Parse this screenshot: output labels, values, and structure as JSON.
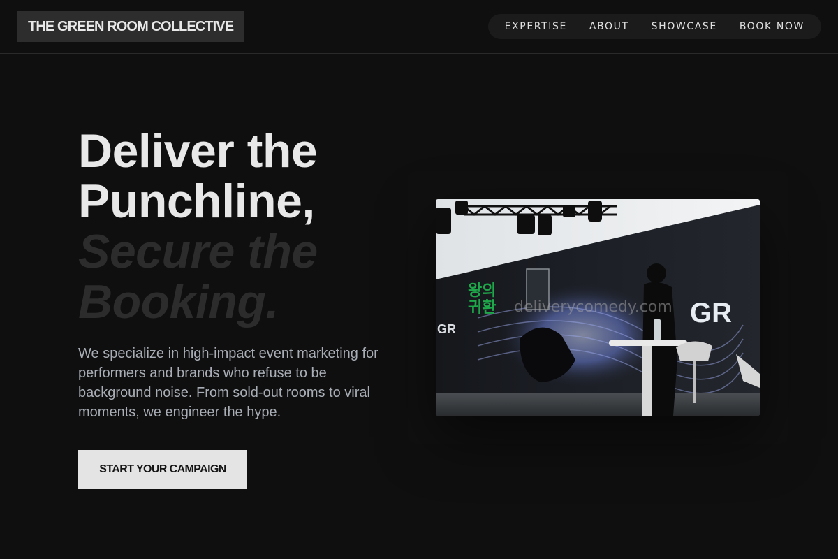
{
  "header": {
    "logo": "THE GREEN ROOM COLLECTIVE",
    "nav": [
      {
        "label": "EXPERTISE"
      },
      {
        "label": "ABOUT"
      },
      {
        "label": "SHOWCASE"
      },
      {
        "label": "BOOK NOW"
      }
    ]
  },
  "hero": {
    "title_lines": [
      "Deliver the",
      "Punchline,"
    ],
    "accent_lines": [
      "Secure the",
      "Booking."
    ],
    "description": "We specialize in high-impact event marketing for performers and brands who refuse to be background noise. From sold-out rooms to viral moments, we engineer the hype.",
    "cta": "START YOUR CAMPAIGN"
  },
  "media": {
    "watermark": "deliverycomedy.com",
    "screen_text_left": "GR",
    "screen_text_right": "GR",
    "screen_korean_1": "왕의",
    "screen_korean_2": "귀환"
  },
  "colors": {
    "background": "#0f0f0f",
    "cta_bg": "#e4e4e4",
    "accent_text": "#2c2c2c",
    "screen_green": "#1fa84a"
  }
}
